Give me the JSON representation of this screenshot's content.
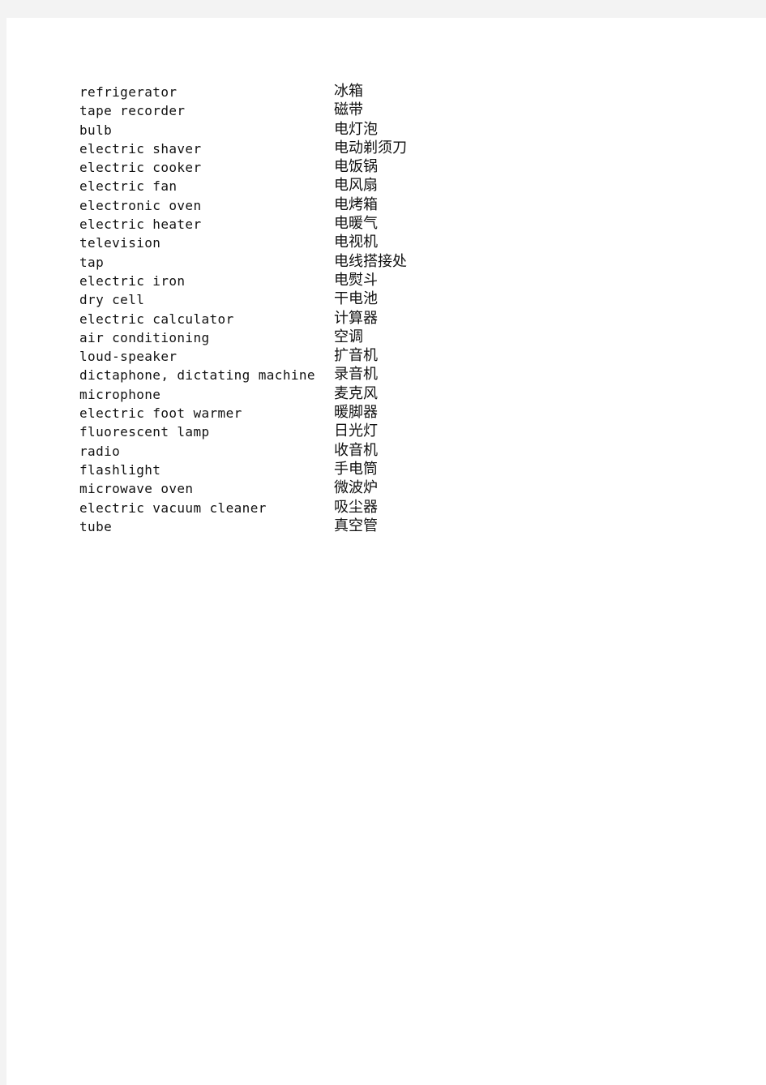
{
  "document": {
    "vocabulary": [
      {
        "english": "refrigerator",
        "chinese": "冰箱"
      },
      {
        "english": "tape recorder",
        "chinese": "磁带"
      },
      {
        "english": "bulb",
        "chinese": "电灯泡"
      },
      {
        "english": "electric shaver",
        "chinese": "电动剃须刀"
      },
      {
        "english": "electric cooker",
        "chinese": "电饭锅"
      },
      {
        "english": "electric fan",
        "chinese": "电风扇"
      },
      {
        "english": "electronic oven",
        "chinese": "电烤箱"
      },
      {
        "english": "electric heater",
        "chinese": "电暖气"
      },
      {
        "english": "television",
        "chinese": "电视机"
      },
      {
        "english": "tap",
        "chinese": "电线搭接处"
      },
      {
        "english": "electric iron",
        "chinese": "电熨斗"
      },
      {
        "english": "dry cell",
        "chinese": "干电池"
      },
      {
        "english": "electric calculator",
        "chinese": "计算器"
      },
      {
        "english": "air conditioning",
        "chinese": "空调"
      },
      {
        "english": "loud-speaker",
        "chinese": "扩音机"
      },
      {
        "english": "dictaphone, dictating machine",
        "chinese": "录音机"
      },
      {
        "english": "microphone",
        "chinese": "麦克风"
      },
      {
        "english": "electric foot warmer",
        "chinese": "暖脚器"
      },
      {
        "english": "fluorescent lamp",
        "chinese": "日光灯"
      },
      {
        "english": "radio",
        "chinese": "收音机"
      },
      {
        "english": "flashlight",
        "chinese": "手电筒"
      },
      {
        "english": "microwave oven",
        "chinese": "微波炉"
      },
      {
        "english": "electric vacuum cleaner",
        "chinese": "吸尘器"
      },
      {
        "english": "tube",
        "chinese": "真空管"
      }
    ]
  }
}
